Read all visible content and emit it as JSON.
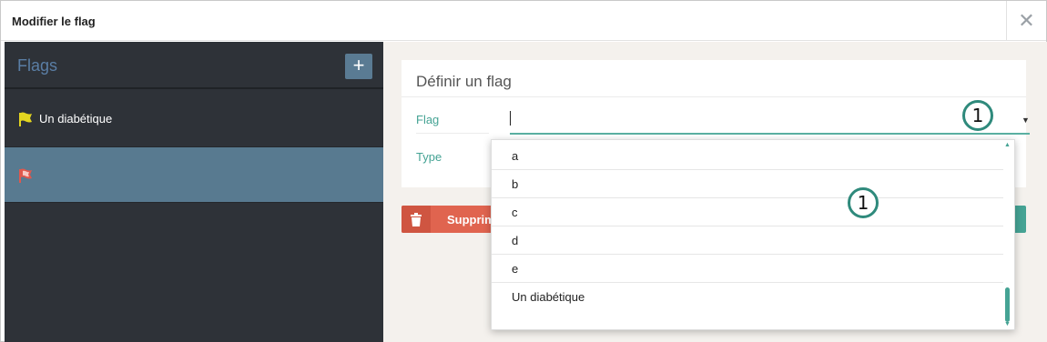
{
  "dialog": {
    "title": "Modifier le flag",
    "close_glyph": "✕"
  },
  "sidebar": {
    "header_label": "Flags",
    "add_glyph": "+",
    "items": [
      {
        "label": "Un diabétique",
        "flag_color": "#e3d520",
        "icon": "flag-icon"
      },
      {
        "label": "",
        "flag_color": "#e0584d",
        "icon": "flag-icon",
        "selected": true
      }
    ]
  },
  "form": {
    "heading": "Définir un flag",
    "flag_label": "Flag",
    "flag_value": "",
    "type_label": "Type"
  },
  "actions": {
    "delete_label": "Supprimer"
  },
  "dropdown": {
    "items": [
      "a",
      "b",
      "c",
      "d",
      "e",
      "Un diabétique"
    ]
  },
  "callouts": [
    "1",
    "1"
  ],
  "colors": {
    "accent_teal": "#45a394",
    "sidebar_bg": "#2e3238",
    "selected_bg": "#587a90",
    "delete_red": "#e0644f"
  }
}
